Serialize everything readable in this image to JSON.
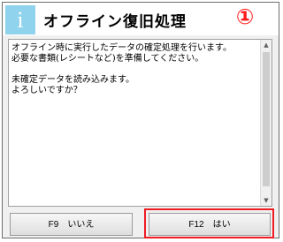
{
  "header": {
    "icon": "info-icon",
    "icon_glyph": "i",
    "title": "オフライン復旧処理",
    "marker": "①",
    "marker_color": "#ff1a1a"
  },
  "message": {
    "lines": [
      "オフライン時に実行したデータの確定処理を行います。",
      "必要な書類(レシートなど)を準備してください。",
      "",
      "未確定データを読み込みます。",
      "よろしいですか？"
    ]
  },
  "buttons": {
    "no_label": "F9　いいえ",
    "yes_label": "F12　はい"
  },
  "colors": {
    "highlight": "#ef1c24",
    "icon_background": "#8fd3ec"
  }
}
